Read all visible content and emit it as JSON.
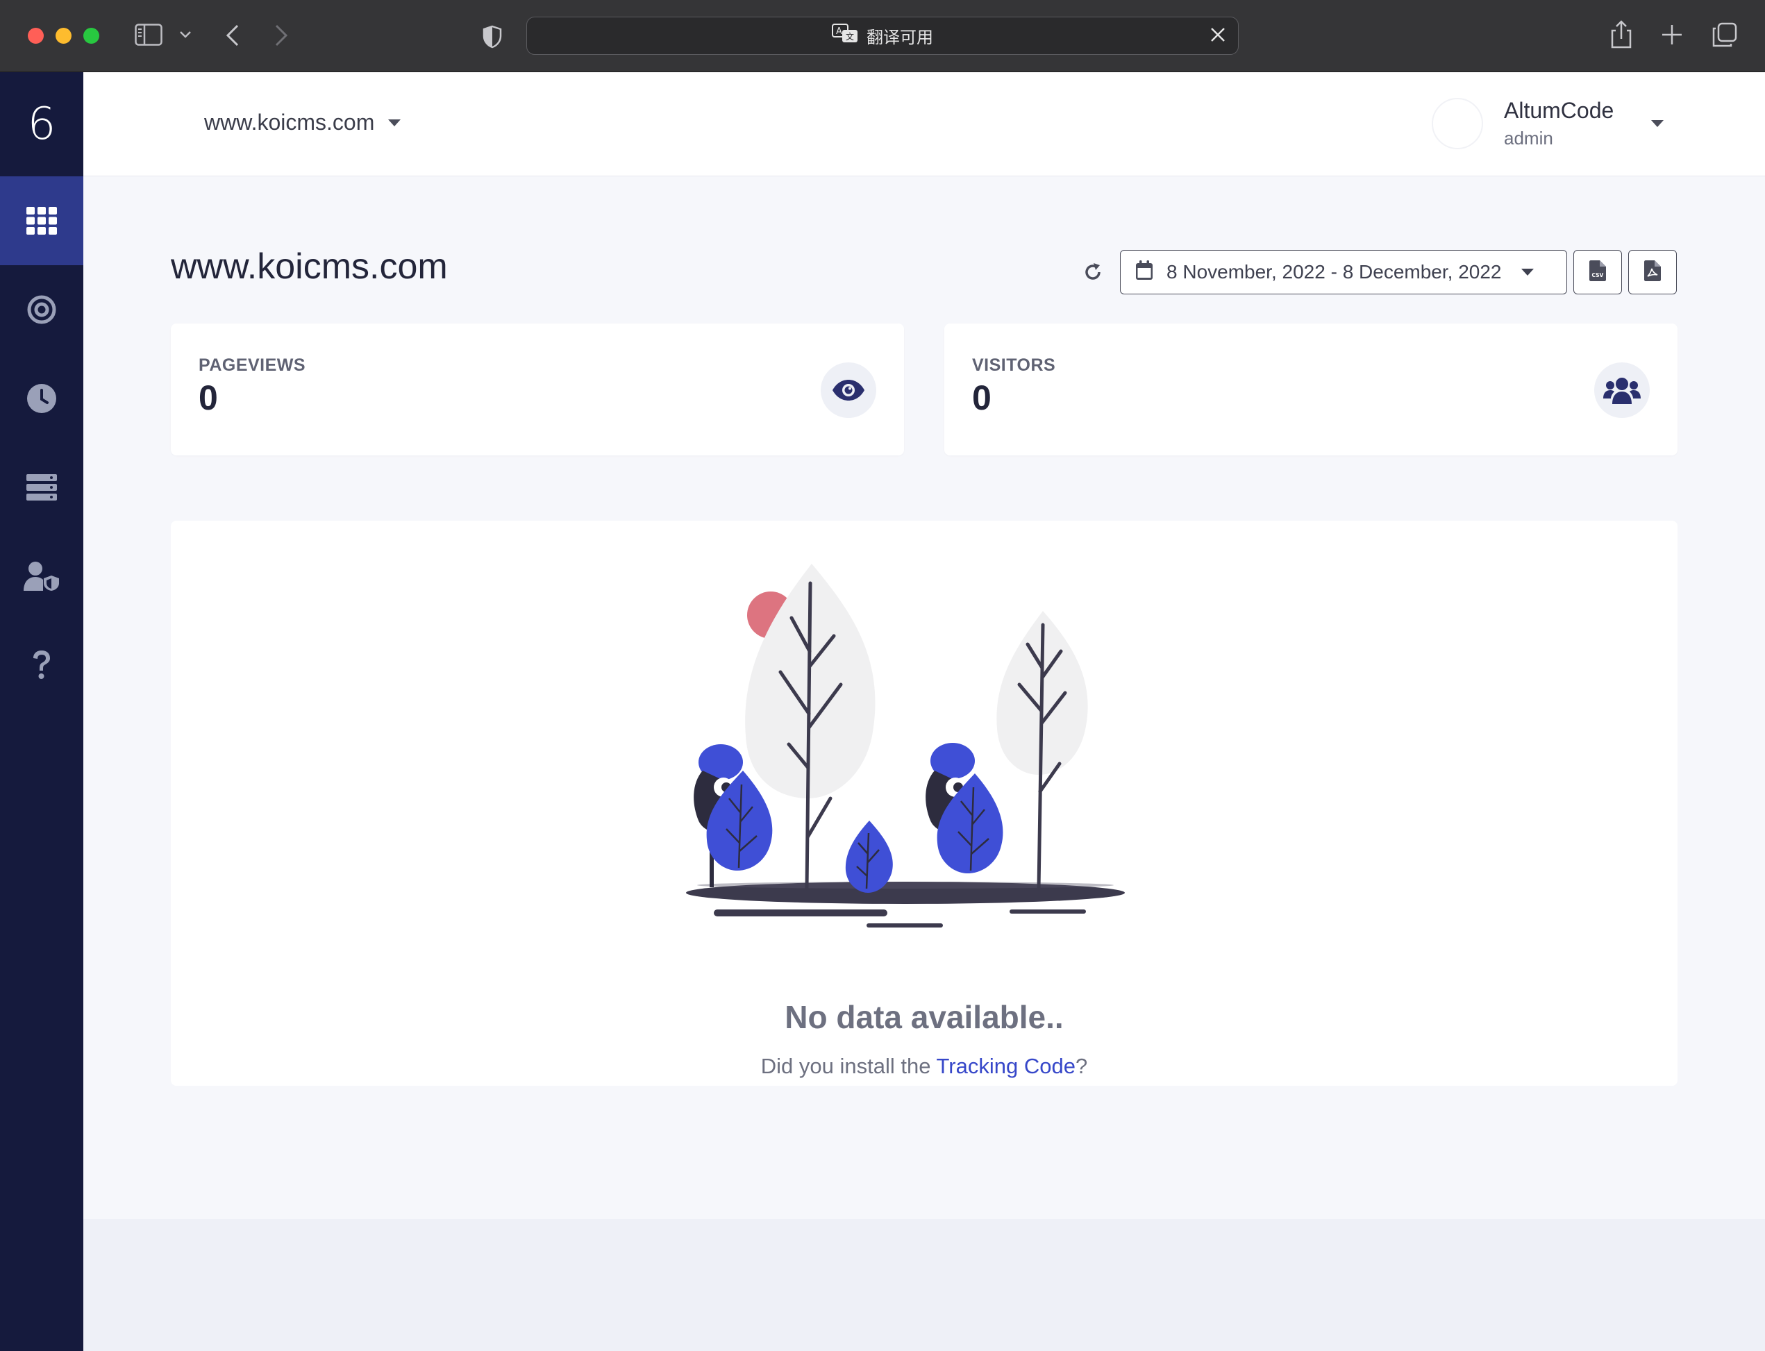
{
  "browser": {
    "address_text": "翻译可用"
  },
  "sidebar": {
    "logo_text": "6",
    "items": [
      {
        "name": "dashboard",
        "icon": "grid-icon",
        "active": true
      },
      {
        "name": "goals",
        "icon": "target-icon",
        "active": false
      },
      {
        "name": "realtime",
        "icon": "clock-icon",
        "active": false
      },
      {
        "name": "websites",
        "icon": "server-icon",
        "active": false
      },
      {
        "name": "admin",
        "icon": "user-shield-icon",
        "active": false
      },
      {
        "name": "help",
        "icon": "question-icon",
        "active": false
      }
    ]
  },
  "header": {
    "site_selector": "www.koicms.com",
    "user_name": "AltumCode",
    "user_role": "admin"
  },
  "page": {
    "title": "www.koicms.com",
    "date_range": "8 November, 2022 - 8 December, 2022"
  },
  "stats": {
    "pageviews_label": "PAGEVIEWS",
    "pageviews_value": "0",
    "visitors_label": "VISITORS",
    "visitors_value": "0"
  },
  "empty_state": {
    "title": "No data available..",
    "sub_before": "Did you install the ",
    "sub_link": "Tracking Code",
    "sub_after": "?"
  },
  "colors": {
    "sidebar_bg": "#151a3d",
    "sidebar_active": "#2e3a8c",
    "accent": "#3647c9",
    "icon_dark": "#2a2f6e"
  }
}
